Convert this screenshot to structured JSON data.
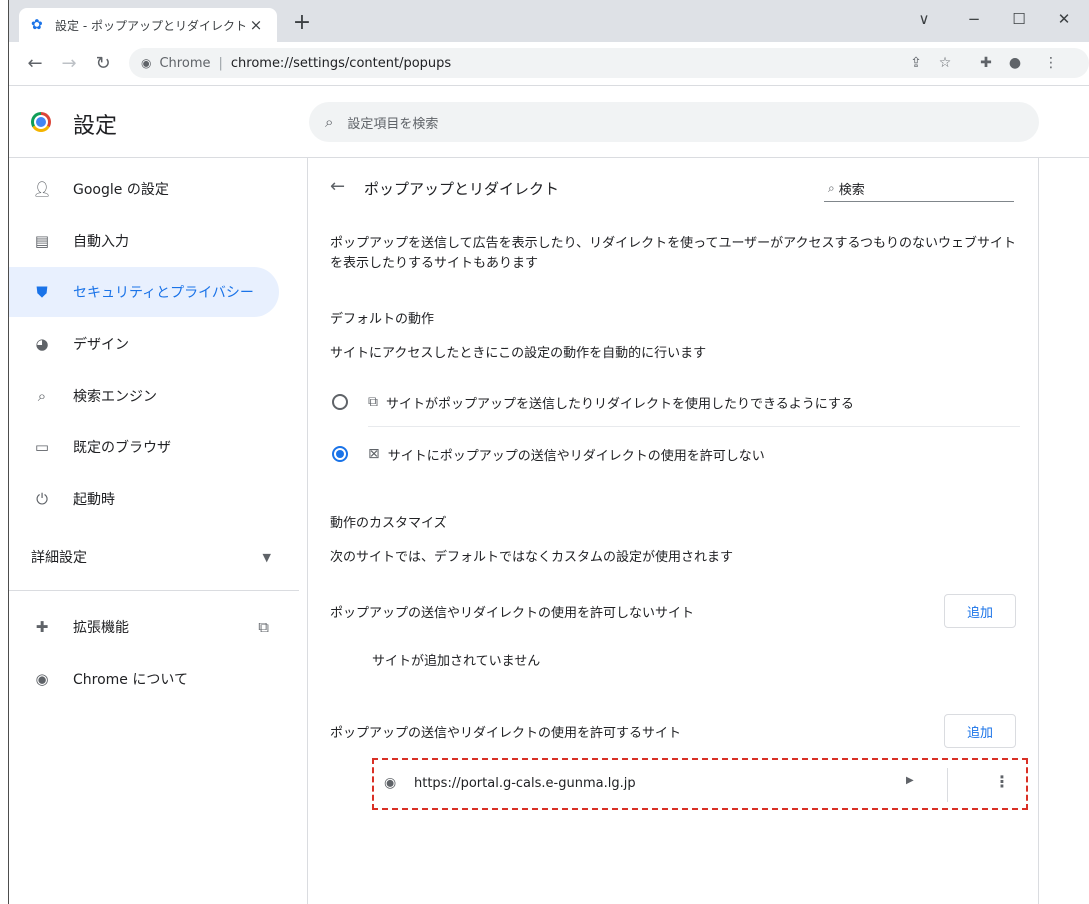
{
  "tab": {
    "title": "設定 - ポップアップとリダイレクト",
    "close_label": "×",
    "new_tab_label": "+"
  },
  "window_controls": {
    "dropdown": "∨",
    "minimize": "−",
    "maximize": "☐",
    "close": "✕"
  },
  "toolbar": {
    "site_label": "Chrome",
    "separator": "|",
    "url": "chrome://settings/content/popups"
  },
  "header": {
    "title": "設定",
    "search_placeholder": "設定項目を検索"
  },
  "sidebar": {
    "items": [
      {
        "label": "Google の設定",
        "icon": "person-icon"
      },
      {
        "label": "自動入力",
        "icon": "clipboard-icon"
      },
      {
        "label": "セキュリティとプライバシー",
        "icon": "shield-icon"
      },
      {
        "label": "デザイン",
        "icon": "palette-icon"
      },
      {
        "label": "検索エンジン",
        "icon": "search-icon"
      },
      {
        "label": "既定のブラウザ",
        "icon": "browser-icon"
      },
      {
        "label": "起動時",
        "icon": "power-icon"
      }
    ],
    "advanced_label": "詳細設定",
    "extensions_label": "拡張機能",
    "about_label": "Chrome について"
  },
  "main": {
    "title": "ポップアップとリダイレクト",
    "search_label": "検索",
    "description": "ポップアップを送信して広告を表示したり、リダイレクトを使ってユーザーがアクセスするつもりのないウェブサイトを表示したりするサイトもあります",
    "default_behavior_title": "デフォルトの動作",
    "default_behavior_desc": "サイトにアクセスしたときにこの設定の動作を自動的に行います",
    "options": [
      {
        "label": "サイトがポップアップを送信したりリダイレクトを使用したりできるようにする",
        "checked": false
      },
      {
        "label": "サイトにポップアップの送信やリダイレクトの使用を許可しない",
        "checked": true
      }
    ],
    "customize_title": "動作のカスタマイズ",
    "customize_desc": "次のサイトでは、デフォルトではなくカスタムの設定が使用されます",
    "block_section_title": "ポップアップの送信やリダイレクトの使用を許可しないサイト",
    "block_empty": "サイトが追加されていません",
    "allow_section_title": "ポップアップの送信やリダイレクトの使用を許可するサイト",
    "add_label": "追加",
    "allowed_sites": [
      "https://portal.g-cals.e-gunma.lg.jp"
    ]
  },
  "colors": {
    "accent": "#1a73e8",
    "active_bg": "#e8f0fe",
    "highlight_border": "#d93025"
  }
}
